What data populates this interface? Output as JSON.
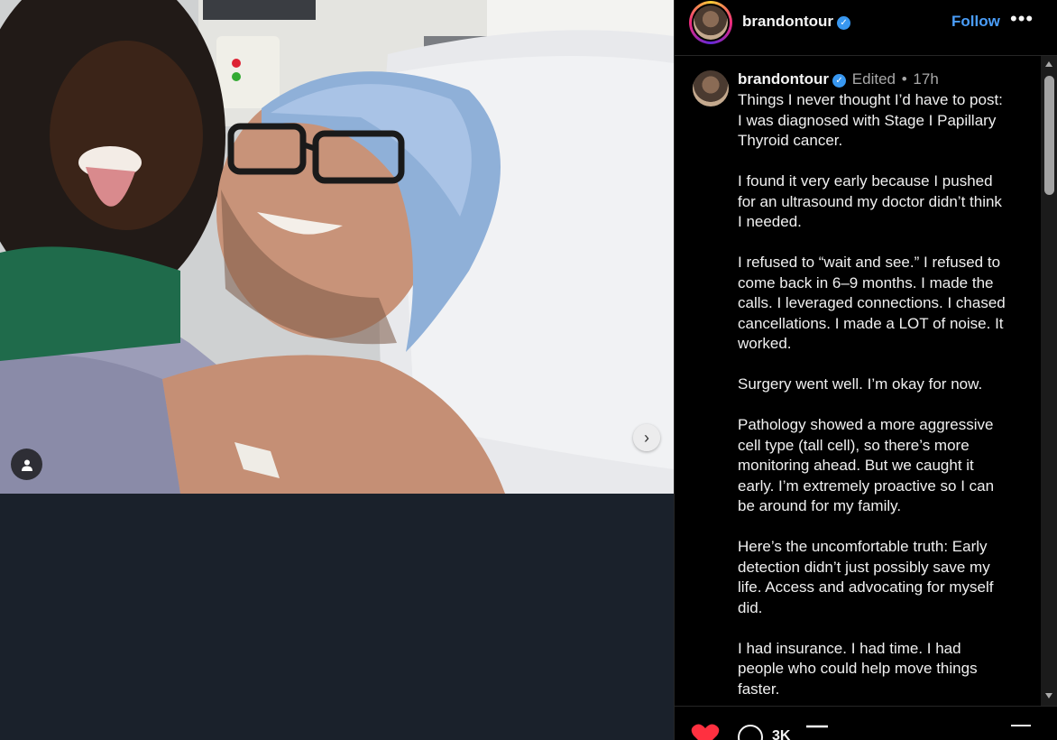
{
  "post": {
    "username": "brandontour",
    "verified": true,
    "follow_label": "Follow",
    "more_label": "•••"
  },
  "caption": {
    "username": "brandontour",
    "edited_label": "Edited",
    "separator": "•",
    "time": "17h",
    "paragraphs": [
      "Things I never thought I’d have to post: I was diagnosed with Stage I Papillary Thyroid cancer.",
      "I found it very early because I pushed for an ultrasound my doctor didn’t think I needed.",
      "I refused to “wait and see.” I refused to come back in 6–9 months. I made the calls. I leveraged connections. I chased cancellations. I made a LOT of noise. It worked.",
      "Surgery went well. I’m okay for now.",
      "Pathology showed a more aggressive cell type (tall cell), so there’s more monitoring ahead. But we caught it early. I’m extremely proactive so I can be around for my family.",
      "Here’s the uncomfortable truth: Early detection didn’t just possibly save my life. Access and advocating for myself did.",
      "I had insurance. I had time. I had people who could help move things faster."
    ]
  },
  "actions": {
    "comment_count": "3K"
  },
  "colors": {
    "accent_blue": "#4a9df8",
    "like_red": "#ff3040",
    "panel_bg": "#000000",
    "media_bg": "#1a212b"
  },
  "icons": {
    "next": "chevron-right-icon",
    "tag": "user-tag-icon",
    "verified": "verified-badge-icon",
    "like": "heart-icon",
    "comment": "comment-icon",
    "share": "share-icon",
    "save": "bookmark-icon"
  }
}
